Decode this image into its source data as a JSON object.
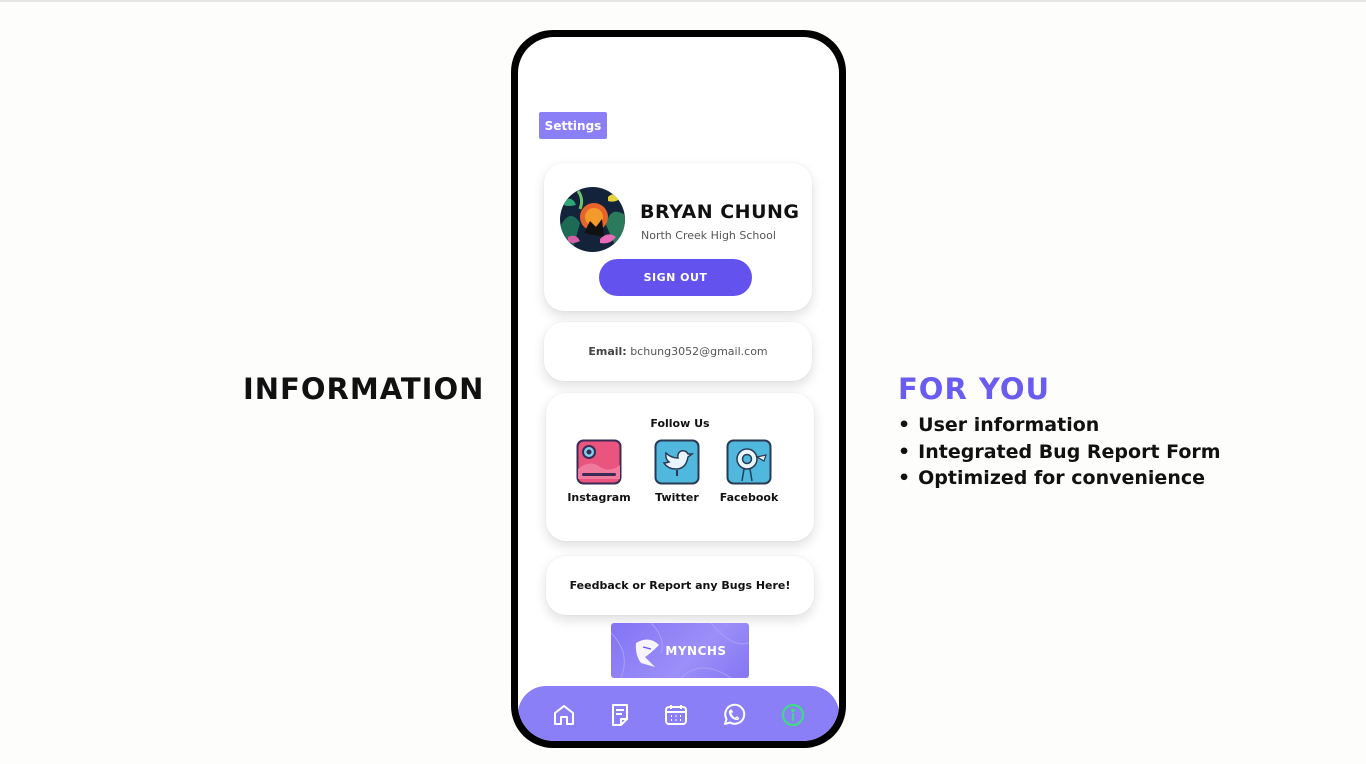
{
  "slide": {
    "left_heading": "INFORMATION",
    "right_heading": "FOR YOU",
    "bullets": [
      "User information",
      "Integrated Bug Report Form",
      "Optimized for convenience"
    ]
  },
  "app": {
    "settings_label": "Settings",
    "profile": {
      "name": "BRYAN CHUNG",
      "school": "North Creek High School",
      "signout_label": "SIGN OUT"
    },
    "email": {
      "label": "Email:",
      "value": "bchung3052@gmail.com"
    },
    "follow": {
      "title": "Follow Us",
      "items": [
        {
          "label": "Instagram",
          "icon": "instagram-icon"
        },
        {
          "label": "Twitter",
          "icon": "twitter-icon"
        },
        {
          "label": "Facebook",
          "icon": "facebook-icon"
        }
      ]
    },
    "feedback_label": "Feedback or Report any Bugs Here!",
    "logo_text": "MYNCHS",
    "nav": [
      "home-icon",
      "document-icon",
      "calendar-icon",
      "whatsapp-icon",
      "info-icon"
    ],
    "colors": {
      "accent": "#6452ee",
      "nav_bg": "#8b7ff8",
      "active": "#3ddc84"
    }
  }
}
